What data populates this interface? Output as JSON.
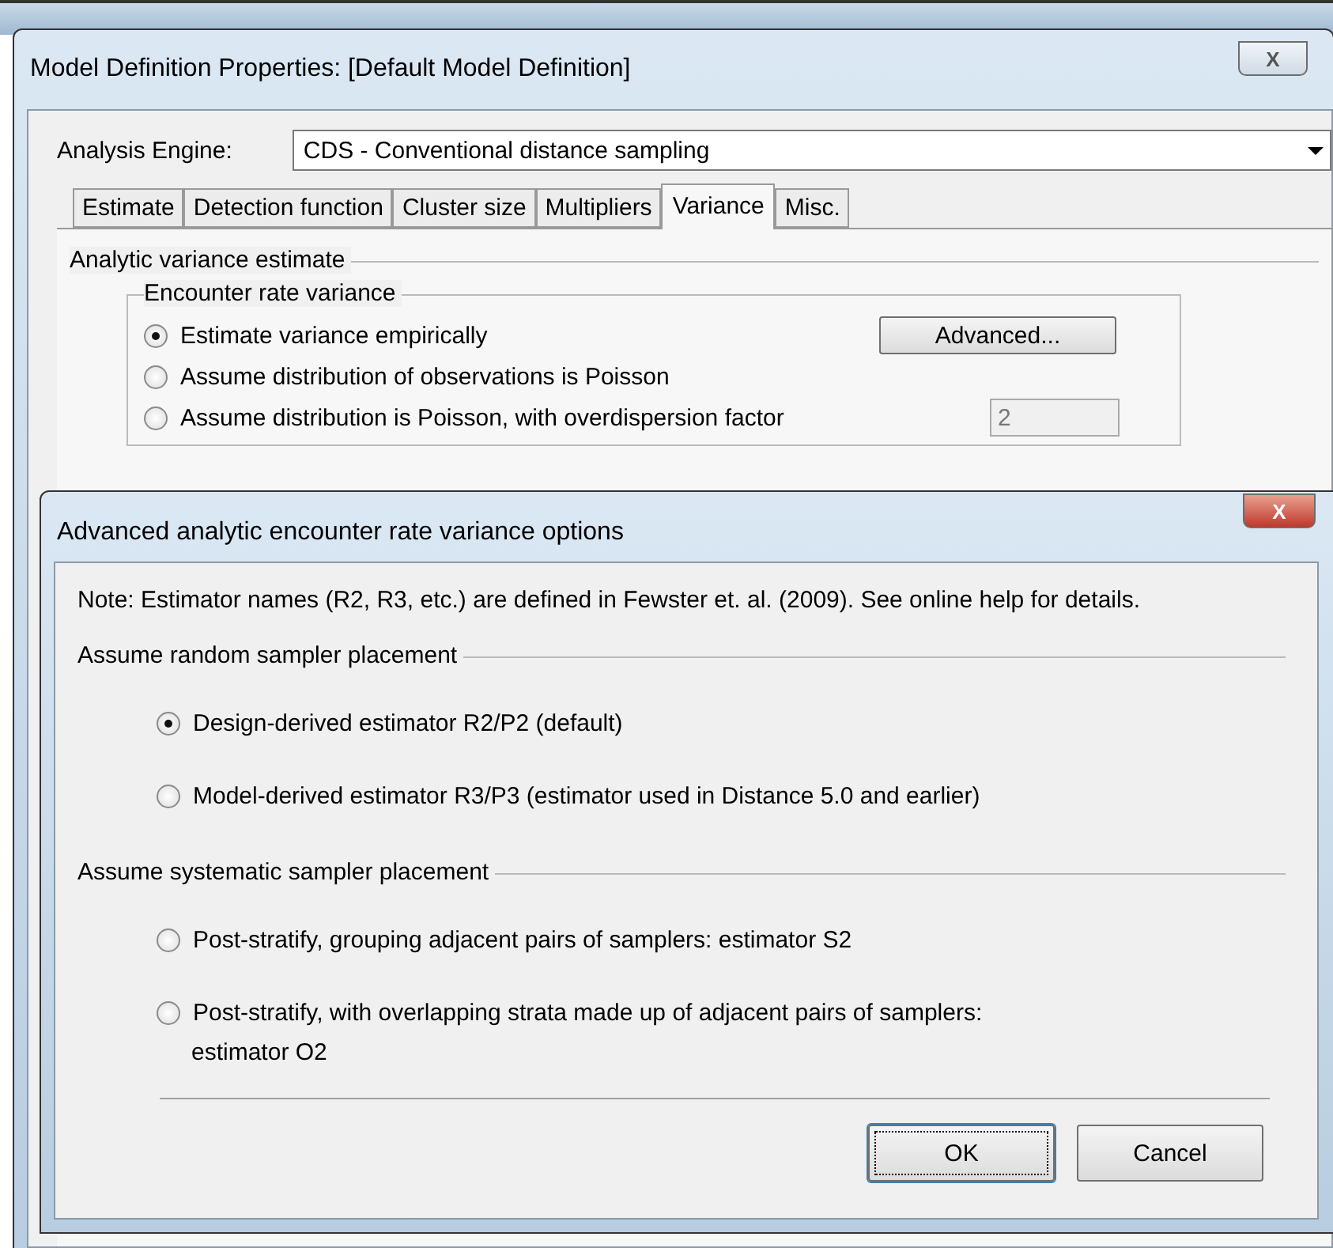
{
  "main_window": {
    "title": "Model Definition Properties: [Default Model Definition]",
    "close_glyph": "X",
    "engine_label": "Analysis Engine:",
    "engine_value": "CDS - Conventional distance sampling",
    "tabs": [
      {
        "label": "Estimate",
        "selected": false
      },
      {
        "label": "Detection function",
        "selected": false
      },
      {
        "label": "Cluster size",
        "selected": false
      },
      {
        "label": "Multipliers",
        "selected": false
      },
      {
        "label": "Variance",
        "selected": true
      },
      {
        "label": "Misc.",
        "selected": false
      }
    ],
    "group_title": "Analytic variance estimate",
    "subgroup_title": "Encounter rate variance",
    "options": [
      {
        "label": "Estimate variance empirically",
        "selected": true
      },
      {
        "label": "Assume distribution of observations is Poisson",
        "selected": false
      },
      {
        "label": "Assume distribution is Poisson, with overdispersion factor",
        "selected": false
      }
    ],
    "advanced_button": "Advanced...",
    "overdispersion_value": "2"
  },
  "dialog": {
    "title": "Advanced analytic encounter rate variance options",
    "close_glyph": "X",
    "note": "Note: Estimator names (R2, R3, etc.) are defined in Fewster et. al. (2009).  See online help for details.",
    "sections": [
      {
        "title": "Assume random sampler placement",
        "options": [
          {
            "label": "Design-derived estimator R2/P2 (default)",
            "selected": true
          },
          {
            "label": "Model-derived estimator R3/P3 (estimator used in Distance 5.0 and earlier)",
            "selected": false
          }
        ]
      },
      {
        "title": "Assume systematic sampler placement",
        "options": [
          {
            "label": "Post-stratify, grouping adjacent pairs of samplers: estimator S2",
            "selected": false
          },
          {
            "label": "Post-stratify, with overlapping strata  made up of adjacent pairs of samplers:",
            "continuation": "estimator O2",
            "selected": false
          }
        ]
      }
    ],
    "buttons": [
      {
        "label": "OK",
        "default": true
      },
      {
        "label": "Cancel",
        "default": false
      }
    ]
  }
}
